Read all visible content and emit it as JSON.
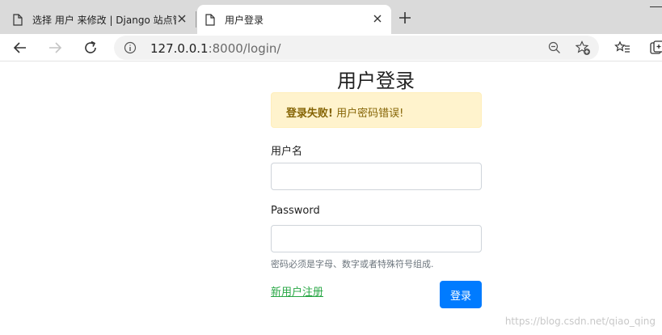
{
  "browser": {
    "tabs": [
      {
        "title": "选择 用户 来修改 | Django 站点管理",
        "active": false,
        "icon": "page-icon"
      },
      {
        "title": "用户登录",
        "active": true,
        "icon": "page-icon"
      }
    ],
    "url": {
      "host": "127.0.0.1",
      "rest": ":8000/login/"
    }
  },
  "page": {
    "heading": "用户登录",
    "alert": {
      "strong": "登录失败!",
      "message": " 用户密码错误!"
    },
    "username": {
      "label": "用户名",
      "value": ""
    },
    "password": {
      "label": "Password",
      "value": "",
      "help": "密码必须是字母、数字或者特殊符号组成."
    },
    "register_link": "新用户注册",
    "login_button": "登录",
    "watermark": "https://blog.csdn.net/qiao_qing"
  },
  "colors": {
    "alert_bg": "#fff3cd",
    "alert_text": "#856404",
    "primary": "#007bff",
    "link": "#28a745"
  }
}
